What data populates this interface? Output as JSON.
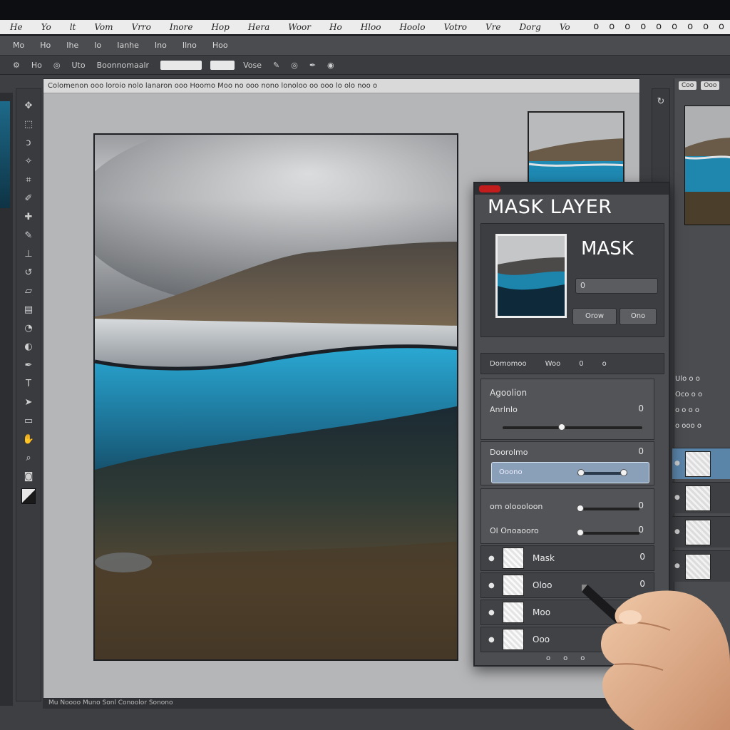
{
  "menubar": {
    "items": [
      "He",
      "Yo",
      "lt",
      "Vom",
      "Vrro",
      "Inore",
      "Hop",
      "Hera",
      "Woor",
      "Ho",
      "Hloo",
      "Hoolo",
      "Votro",
      "Vre",
      "Dorg",
      "Vo"
    ],
    "right_icons": [
      "o",
      "o",
      "o",
      "o",
      "o",
      "o",
      "o",
      "o",
      "o"
    ]
  },
  "optionsbar": {
    "items": [
      "Mo",
      "Ho",
      "Ihe",
      "Io",
      "Ianhe",
      "Ino",
      "Ilno",
      "Hoo"
    ]
  },
  "tooloptions": {
    "items": [
      "Ho",
      "Uto",
      "Boonnomaalr",
      "Vose"
    ]
  },
  "document": {
    "title": "Colomenon ooo loroio nolo lanaron ooo Hoomo Moo no ooo nono lonoloo oo ooo lo olo noo o",
    "status": "Mu Noooo Muno Sonl Conoolor Sonono"
  },
  "right_panel": {
    "tabs": [
      "Coo",
      "Ooo"
    ],
    "grid_rows": [
      "Ulo o o",
      "Oco o o",
      "o o o o",
      "o ooo o"
    ]
  },
  "mask_panel": {
    "title": "MASK LAYER",
    "mask_label": "MASK",
    "field_value": "0",
    "button_left": "Orow",
    "button_right": "Ono",
    "subheader": [
      "Domomoo",
      "Woo",
      "0",
      "o"
    ],
    "section_title": "Agoolion",
    "properties": [
      {
        "label": "Anrlnlo",
        "value": "0"
      },
      {
        "label": "Doorolmo",
        "value": "0"
      },
      {
        "label": "Ooono",
        "value": ""
      },
      {
        "label": "om oloooloon",
        "value": "0"
      },
      {
        "label": "Ol Onoaooro",
        "value": "0"
      }
    ],
    "layers": [
      {
        "name": "Mask",
        "value": "0"
      },
      {
        "name": "Oloo",
        "value": "0"
      },
      {
        "name": "Moo",
        "value": ""
      },
      {
        "name": "Ooo",
        "value": ""
      }
    ],
    "footer": [
      "o",
      "o",
      "o"
    ]
  },
  "colors": {
    "accent": "#5a84a8",
    "panel": "#4b4d51",
    "close": "#c31c1c"
  }
}
